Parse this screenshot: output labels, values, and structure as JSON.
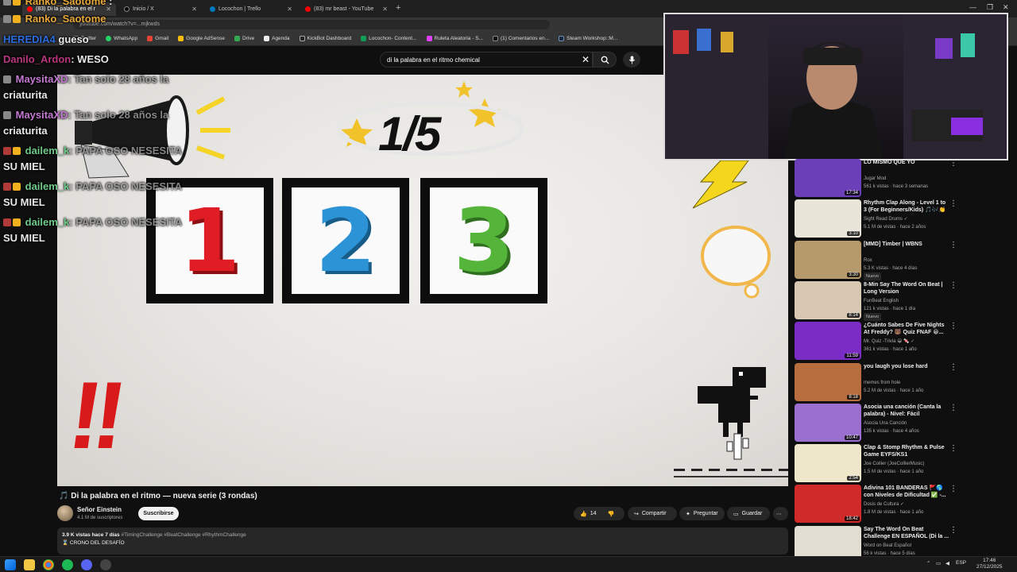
{
  "browser": {
    "tabs": [
      {
        "title": "(83) Di la palabra en el r",
        "active": true
      },
      {
        "title": "Inicio / X",
        "active": false
      },
      {
        "title": "Locochon | Trello",
        "active": false
      },
      {
        "title": "(83) mr beast - YouTube",
        "active": false
      }
    ],
    "new_tab": "+",
    "url": "youtube.com/watch?v=...mjkwds",
    "bookmarks": [
      "Twitter",
      "WhatsApp",
      "Gmail",
      "Google AdSense",
      "Drive",
      "Agenda",
      "KickBot Dashboard",
      "Locochon- Content...",
      "Ruleta Aleatoria - S...",
      "(1) Comentarios en...",
      "Steam Workshop::M..."
    ]
  },
  "youtube": {
    "search_value": "di la palabra en el ritmo chemical",
    "video_title": "🎵 Di la palabra en el ritmo — nueva serie (3 rondas)",
    "channel": "Señor Einstein",
    "subscribers": "4.1 M de suscriptores",
    "subscribe_label": "Suscribirse",
    "likes": "14",
    "share_label": "Compartir",
    "ask_label": "Preguntar",
    "save_label": "Guardar",
    "desc_stats": "3.9 K vistas  hace 7 días",
    "desc_tags": "#TimingChallenge #BeatChallenge #RhythmChallenge",
    "desc_line2": "⌛ CRONO DEL DESAFÍO"
  },
  "video": {
    "counter": "1/5",
    "numbers": [
      "1",
      "2",
      "3"
    ],
    "number_colors": [
      "#e01d24",
      "#2b93d6",
      "#55b53a"
    ],
    "exclaim": "!!"
  },
  "chat": [
    {
      "user": "Ranko_Saotome",
      "msg": ":",
      "color": "#e7a83a"
    },
    {
      "user": "HEREDIA4",
      "msg": "gueso",
      "color": "#2d6cdf"
    },
    {
      "user": "Danilo_Ardon",
      "msg": ": WESO",
      "color": "#b8367d"
    },
    {
      "user": "MaysitaXD",
      "msg": ": Tan solo 28 años la",
      "color": "#c47ad2",
      "cont": "criaturita"
    },
    {
      "user": "MaysitaXD",
      "msg": ": Tan solo 28 años la",
      "color": "#c47ad2",
      "cont": "criaturita"
    },
    {
      "user": "dailem_k",
      "msg": ": PAPA OSO NESESITA",
      "color": "#6fcb8a",
      "cont": "SU MIEL"
    },
    {
      "user": "dailem_k",
      "msg": ": PAPA OSO NESESITA",
      "color": "#6fcb8a",
      "cont": "SU MIEL"
    },
    {
      "user": "dailem_k",
      "msg": ": PAPA OSO NESESITA",
      "color": "#6fcb8a",
      "cont": "SU MIEL"
    }
  ],
  "recommendations": [
    {
      "title": "LO MISMO QUE YO",
      "channel": "Jugar Mod",
      "meta": "561 k vistas · hace 3 semanas",
      "duration": "17:34",
      "thumb": "#6a3fb8",
      "new": false
    },
    {
      "title": "Rhythm Clap Along - Level 1 to 3 (For Beginners/Kids) 🎵🎶👏",
      "channel": "Sight Read Drums ✓",
      "meta": "5.1 M de vistas · hace 2 años",
      "duration": "3:10",
      "thumb": "#e9e5d8",
      "new": false
    },
    {
      "title": "[MMD] Timber | WBNS",
      "channel": "Rox",
      "meta": "5.3 K vistas · hace 4 días",
      "duration": "3:30",
      "thumb": "#b79a6b",
      "new": true
    },
    {
      "title": "8-Min Say The Word On Beat | Long Version",
      "channel": "FunBeat English",
      "meta": "121 k vistas · hace 1 día",
      "duration": "8:14",
      "thumb": "#d8c7b2",
      "new": true
    },
    {
      "title": "¿Cuánto Sabes De Five Nights At Freddy? 🐻 Quiz FNAF 😀...",
      "channel": "Mr. Quiz -Trivia 😀 🍬 ✓",
      "meta": "361 k vistas · hace 1 año",
      "duration": "11:59",
      "thumb": "#7a2cc4",
      "new": false
    },
    {
      "title": "you laugh you lose hard",
      "channel": "memes from hole",
      "meta": "5.2 M de vistas · hace 1 año",
      "duration": "8:18",
      "thumb": "#b86d3f",
      "new": false
    },
    {
      "title": "Asocia una canción (Canta la palabra) - Nivel: Fácil",
      "channel": "Asocia Una Canción",
      "meta": "135 k vistas · hace 4 años",
      "duration": "10:47",
      "thumb": "#9a6fd0",
      "new": false
    },
    {
      "title": "Clap & Stomp Rhythm & Pulse Game  EYFS/KS1",
      "channel": "Joe Collier (JoeCollierMusic)",
      "meta": "1.5 M de vistas · hace 1 año",
      "duration": "2:54",
      "thumb": "#efe7c9",
      "new": false
    },
    {
      "title": "Adivina 101 BANDERAS 🚩🌎 con Niveles de Dificultad ✅ -...",
      "channel": "Dosis de Cultura ✓",
      "meta": "1.8 M de vistas · hace 1 año",
      "duration": "18:42",
      "thumb": "#d02a2a",
      "new": false
    },
    {
      "title": "Say The Word On Beat Challenge EN ESPAÑOL (Di la ...",
      "channel": "Word on Beat Español",
      "meta": "56 k vistas · hace 5 días",
      "duration": "",
      "thumb": "#e2ddd2",
      "new": true
    }
  ],
  "taskbar": {
    "lang": "ESP",
    "time": "17:46",
    "date": "27/12/2025"
  }
}
